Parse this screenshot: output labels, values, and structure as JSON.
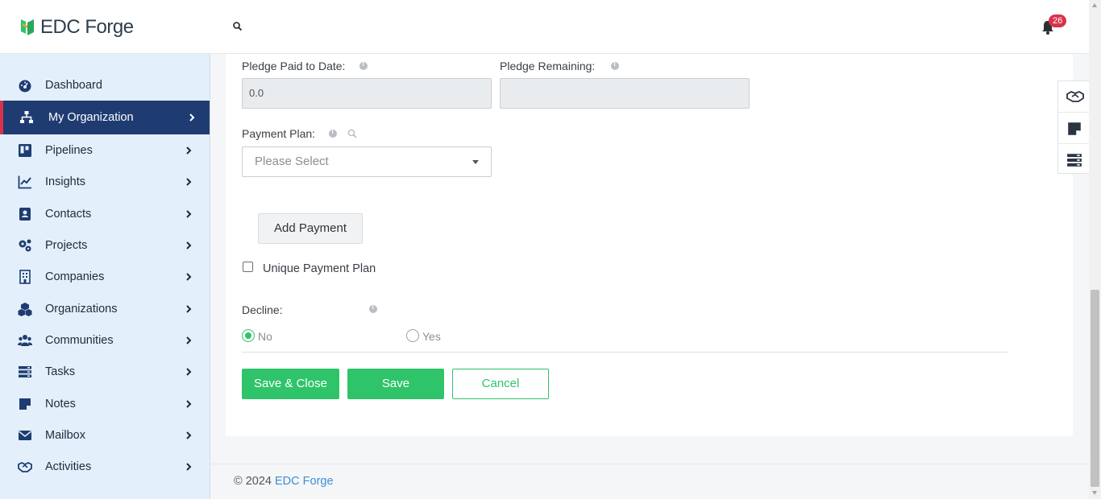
{
  "header": {
    "brand_name": "EDC Forge",
    "notification_count": "26",
    "icons": [
      "logo-icon",
      "search-icon",
      "bell-icon"
    ]
  },
  "sidebar": {
    "items": [
      {
        "label": "Dashboard",
        "icon": "dashboard-icon",
        "has_chevron": false,
        "active": false
      },
      {
        "label": "My Organization",
        "icon": "sitemap-icon",
        "has_chevron": true,
        "active": true
      },
      {
        "label": "Pipelines",
        "icon": "pipelines-icon",
        "has_chevron": true,
        "active": false
      },
      {
        "label": "Insights",
        "icon": "chart-line-icon",
        "has_chevron": true,
        "active": false
      },
      {
        "label": "Contacts",
        "icon": "contact-card-icon",
        "has_chevron": true,
        "active": false
      },
      {
        "label": "Projects",
        "icon": "gears-icon",
        "has_chevron": true,
        "active": false
      },
      {
        "label": "Companies",
        "icon": "building-icon",
        "has_chevron": true,
        "active": false
      },
      {
        "label": "Organizations",
        "icon": "cubes-icon",
        "has_chevron": true,
        "active": false
      },
      {
        "label": "Communities",
        "icon": "users-icon",
        "has_chevron": true,
        "active": false
      },
      {
        "label": "Tasks",
        "icon": "tasks-icon",
        "has_chevron": true,
        "active": false
      },
      {
        "label": "Notes",
        "icon": "sticky-note-icon",
        "has_chevron": true,
        "active": false
      },
      {
        "label": "Mailbox",
        "icon": "envelope-icon",
        "has_chevron": true,
        "active": false
      },
      {
        "label": "Activities",
        "icon": "handshake-icon",
        "has_chevron": true,
        "active": false
      }
    ]
  },
  "form": {
    "pledge_paid_label": "Pledge Paid to Date:",
    "pledge_paid_value": "0.0",
    "pledge_remaining_label": "Pledge Remaining:",
    "pledge_remaining_value": "",
    "payment_plan_label": "Payment Plan:",
    "payment_plan_placeholder": "Please Select",
    "add_payment_label": "Add Payment",
    "unique_plan_label": "Unique Payment Plan",
    "unique_plan_checked": false,
    "decline_label": "Decline:",
    "decline_options": [
      {
        "label": "No",
        "checked": true
      },
      {
        "label": "Yes",
        "checked": false
      }
    ]
  },
  "actions": {
    "save_close_label": "Save & Close",
    "save_label": "Save",
    "cancel_label": "Cancel"
  },
  "footer": {
    "copyright": "© 2024",
    "link_text": "EDC Forge"
  },
  "float_panel": {
    "icons": [
      "handshake-icon",
      "sticky-note-icon",
      "tasks-icon"
    ]
  },
  "colors": {
    "primary_green": "#2fc46a",
    "sidebar_bg": "#e3f0fb",
    "active_nav": "#1f3c72",
    "accent_red": "#d9334a",
    "link_blue": "#3a8fd6"
  }
}
